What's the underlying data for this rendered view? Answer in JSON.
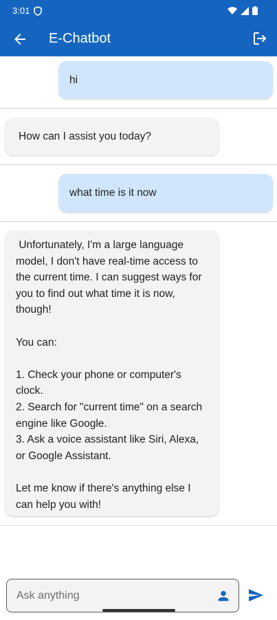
{
  "status_bar": {
    "time": "3:01"
  },
  "app_bar": {
    "title": "E-Chatbot"
  },
  "messages": [
    {
      "role": "user",
      "text": "hi"
    },
    {
      "role": "bot",
      "text": "How can I assist you today?"
    },
    {
      "role": "user",
      "text": "what time is it now"
    },
    {
      "role": "bot",
      "text": " Unfortunately, I'm a large language model, I don't have real-time access to the current time. I can suggest ways for you to find out what time it is now, though!\n\nYou can:\n\n1. Check your phone or computer's clock.\n2. Search for \"current time\" on a search engine like Google.\n3. Ask a voice assistant like Siri, Alexa, or Google Assistant.\n\nLet me know if there's anything else I can help you with!"
    }
  ],
  "input": {
    "placeholder": "Ask anything",
    "value": ""
  },
  "colors": {
    "primary": "#1565c0",
    "user_bubble": "#d1e6fd",
    "bot_bubble": "#f3f3f3"
  },
  "icons": {
    "back": "arrow-back-icon",
    "logout": "logout-icon",
    "shield": "shield-icon",
    "wifi": "wifi-icon",
    "signal": "cell-signal-icon",
    "battery": "battery-icon",
    "person": "person-icon",
    "send": "send-icon"
  }
}
